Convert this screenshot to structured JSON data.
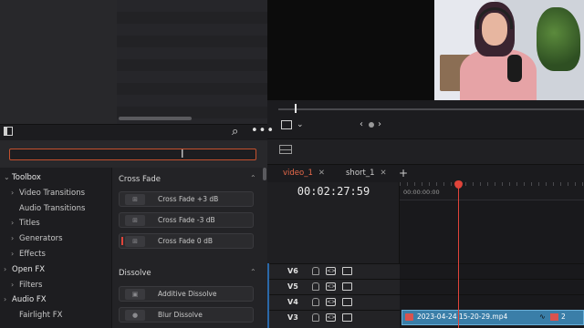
{
  "fx_panel": {
    "search_value": "",
    "tree": [
      {
        "label": "Toolbox",
        "expanded": true,
        "level": 0
      },
      {
        "label": "Video Transitions",
        "expanded": false,
        "level": 1
      },
      {
        "label": "Audio Transitions",
        "expanded": null,
        "level": 1
      },
      {
        "label": "Titles",
        "expanded": false,
        "level": 1
      },
      {
        "label": "Generators",
        "expanded": false,
        "level": 1
      },
      {
        "label": "Effects",
        "expanded": false,
        "level": 1
      },
      {
        "label": "Open FX",
        "expanded": false,
        "level": 0
      },
      {
        "label": "Filters",
        "expanded": false,
        "level": 1
      },
      {
        "label": "Audio FX",
        "expanded": false,
        "level": 0
      },
      {
        "label": "Fairlight FX",
        "expanded": null,
        "level": 1
      }
    ],
    "sections": [
      {
        "title": "Cross Fade",
        "items": [
          "Cross Fade +3 dB",
          "Cross Fade -3 dB",
          "Cross Fade 0 dB"
        ]
      },
      {
        "title": "Dissolve",
        "items": [
          "Additive Dissolve",
          "Blur Dissolve"
        ]
      }
    ]
  },
  "timeline": {
    "tabs": [
      {
        "label": "video_1",
        "active": true
      },
      {
        "label": "short_1",
        "active": false
      }
    ],
    "add_tab": "+",
    "timecode": "00:02:27:59",
    "ruler_start": "00:00:00:00",
    "tracks": [
      "V6",
      "V5",
      "V4",
      "V3"
    ],
    "clip_name": "2023-04-24 15-20-29.mp4",
    "clip_name_2": "2"
  },
  "icons": {
    "search": "search-icon",
    "more": "more-icon",
    "panel": "panel-toggle-icon",
    "crop": "crop-icon",
    "prev": "prev-frame-icon",
    "next": "next-frame-icon"
  },
  "colors": {
    "accent": "#e8694a",
    "playhead": "#e0443a",
    "clip": "#3a7ea8",
    "search_border": "#c4512e"
  }
}
